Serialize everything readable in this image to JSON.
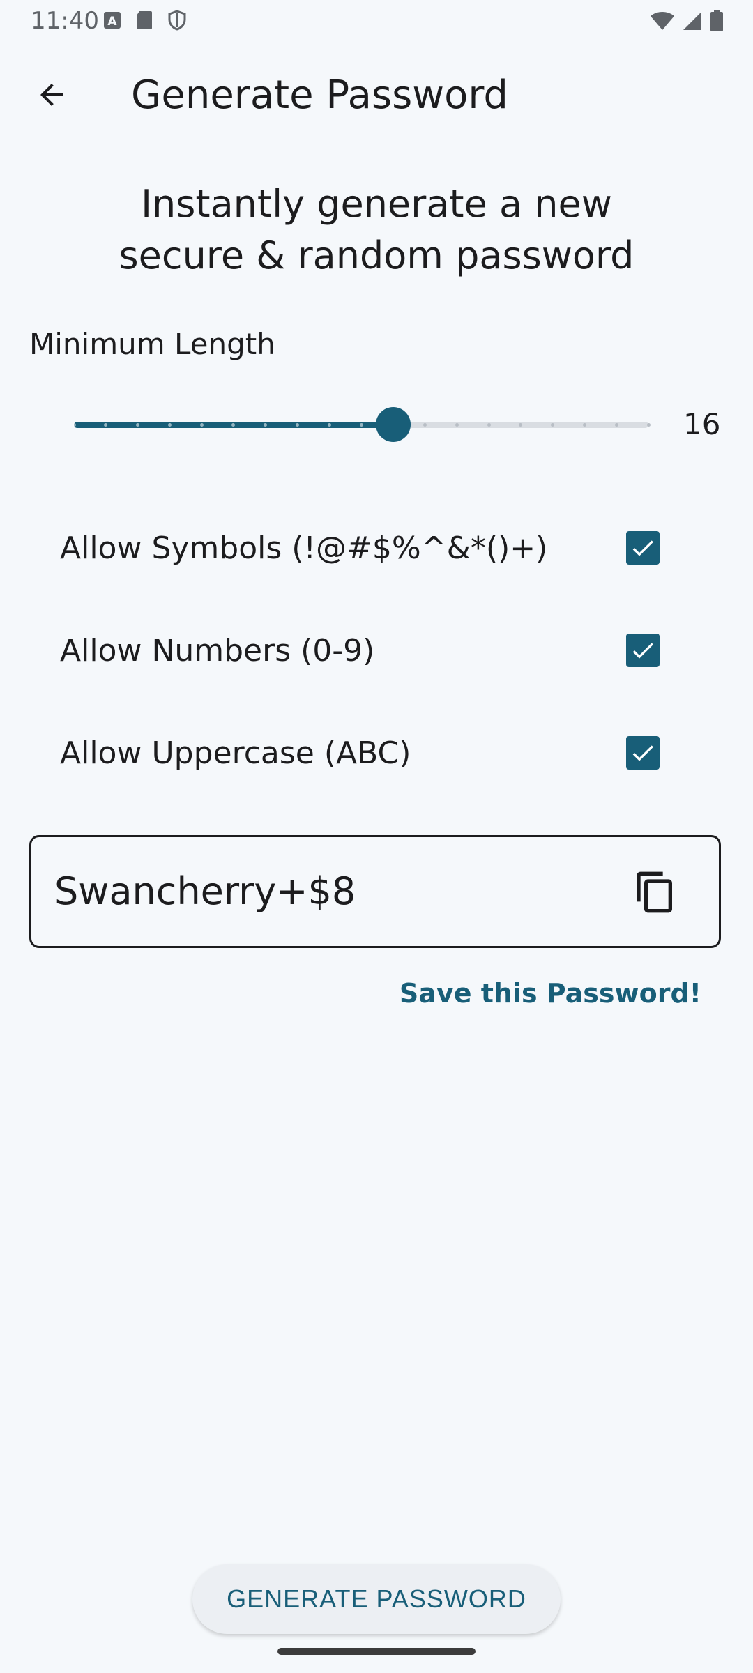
{
  "status_bar": {
    "time": "11:40",
    "left_icons": [
      "text-a-icon",
      "sd-card-icon",
      "shield-icon"
    ],
    "right_icons": [
      "wifi-icon",
      "cell-signal-icon",
      "battery-icon"
    ]
  },
  "app_bar": {
    "back_icon": "arrow-back-icon",
    "title": "Generate Password"
  },
  "headline": {
    "line1": "Instantly generate a new",
    "line2": "secure & random password"
  },
  "length": {
    "label": "Minimum Length",
    "value": "16",
    "slider_min": 6,
    "slider_max": 24,
    "slider_step": 1,
    "slider_value": 16
  },
  "options": [
    {
      "label": "Allow Symbols (!@#$%^&*()+)",
      "checked": true
    },
    {
      "label": "Allow Numbers (0-9)",
      "checked": true
    },
    {
      "label": "Allow Uppercase (ABC)",
      "checked": true
    }
  ],
  "password": {
    "value": "Swancherry+$8",
    "copy_icon": "copy-icon"
  },
  "save_link": "Save this Password!",
  "generate_button": "GENERATE PASSWORD",
  "colors": {
    "accent": "#185e78",
    "background": "#f5f8fb",
    "track_inactive": "#d9dde2"
  }
}
